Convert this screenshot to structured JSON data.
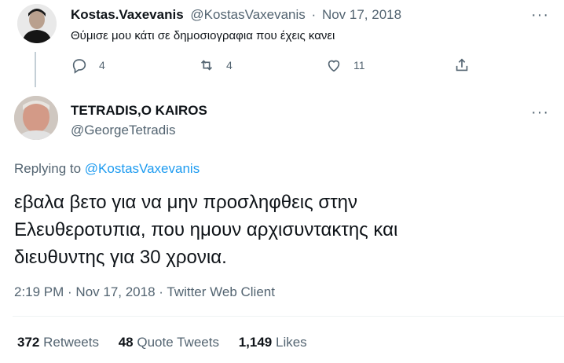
{
  "parent_tweet": {
    "display_name": "Kostas.Vaxevanis",
    "handle": "@KostasVaxevanis",
    "separator": "·",
    "date": "Nov 17, 2018",
    "text": "Θύμισε μου κάτι σε δημοσιογραφια που έχεις κανει",
    "actions": {
      "reply_count": "4",
      "retweet_count": "4",
      "like_count": "11"
    }
  },
  "main_tweet": {
    "display_name": "TETRADIS,O KAIROS",
    "handle": "@GeorgeTetradis",
    "replying_to_prefix": "Replying to",
    "replying_to_handle": "@KostasVaxevanis",
    "text_lines": [
      "εβαλα βετο για να μην προσληφθεις στην",
      "Ελευθεροτυπια, που ημουν αρχισυντακτης και",
      "διευθυντης για 30 χρονια."
    ],
    "meta": "2:19 PM · Nov 17, 2018 · Twitter Web Client",
    "stats": {
      "retweets_count": "372",
      "retweets_label": "Retweets",
      "quote_tweets_count": "48",
      "quote_tweets_label": "Quote Tweets",
      "likes_count": "1,149",
      "likes_label": "Likes"
    }
  },
  "colors": {
    "link": "#1d9bf0",
    "muted": "#536471",
    "text": "#0f1419"
  },
  "icons": [
    "more-icon",
    "reply-icon",
    "retweet-icon",
    "like-icon",
    "share-icon"
  ]
}
